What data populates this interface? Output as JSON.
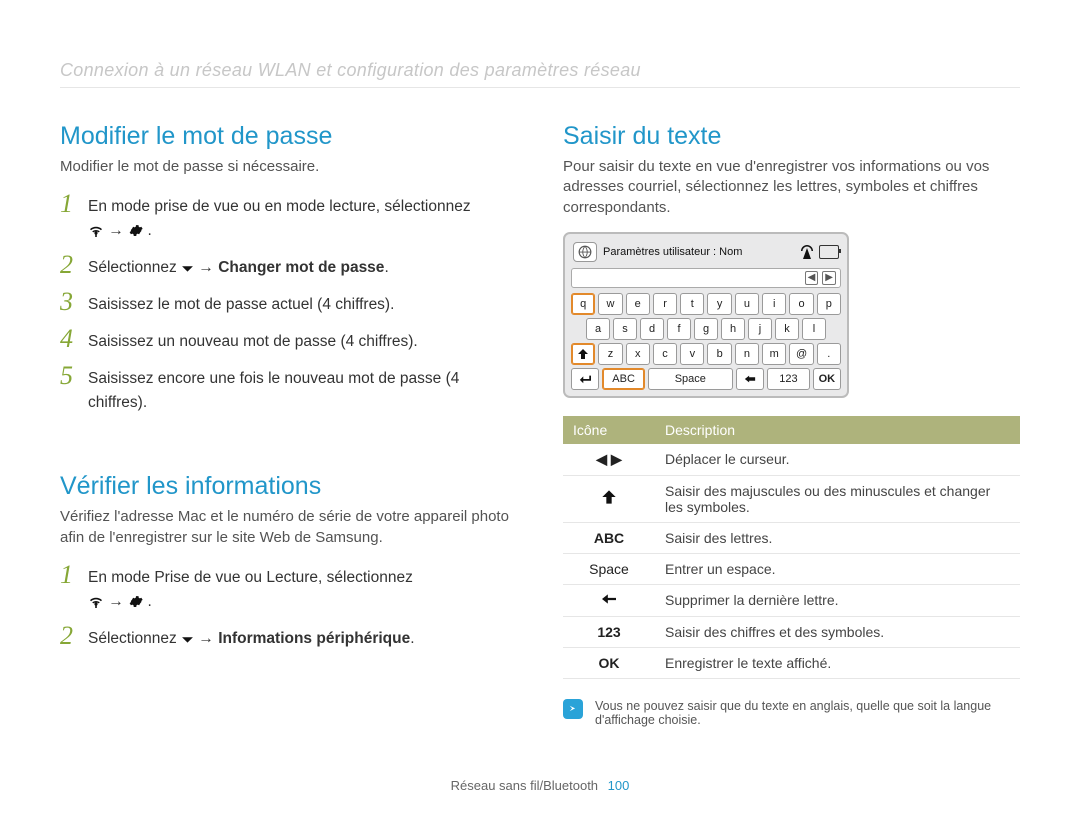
{
  "breadcrumb": "Connexion à un réseau WLAN et configuration des paramètres réseau",
  "arrow": "→",
  "left": {
    "password": {
      "title": "Modifier le mot de passe",
      "lead": "Modifier le mot de passe si nécessaire.",
      "steps": [
        "En mode prise de vue ou en mode lecture, sélectionnez",
        {
          "pre": "Sélectionnez ",
          "bold": "Changer mot de passe",
          "post": "."
        },
        "Saisissez le mot de passe actuel (4 chiffres).",
        "Saisissez un nouveau mot de passe (4 chiffres).",
        "Saisissez encore une fois le nouveau mot de passe (4 chiffres)."
      ]
    },
    "verify": {
      "title": "Vérifier les informations",
      "lead": "Vérifiez l'adresse Mac et le numéro de série de votre appareil photo afin de l'enregistrer sur le site Web de Samsung.",
      "steps": [
        "En mode Prise de vue ou Lecture, sélectionnez",
        {
          "pre": "Sélectionnez ",
          "bold": "Informations périphérique",
          "post": "."
        }
      ]
    }
  },
  "right": {
    "enter": {
      "title": "Saisir du texte",
      "lead": "Pour saisir du texte en vue d'enregistrer vos informations ou vos adresses courriel, sélectionnez les lettres, symboles et chiffres correspondants."
    },
    "keyboard": {
      "top_label": "Paramètres utilisateur : Nom",
      "cursor_left": "◀",
      "cursor_right": "▶",
      "rows": [
        [
          "q",
          "w",
          "e",
          "r",
          "t",
          "y",
          "u",
          "i",
          "o",
          "p"
        ],
        [
          "a",
          "s",
          "d",
          "f",
          "g",
          "h",
          "j",
          "k",
          "l"
        ],
        [
          "z",
          "x",
          "c",
          "v",
          "b",
          "n",
          "m",
          "@",
          "."
        ]
      ],
      "bottom": {
        "abc": "ABC",
        "space": "Space",
        "num": "123",
        "ok": "OK"
      }
    },
    "table": {
      "h1": "Icône",
      "h2": "Description",
      "rows": [
        {
          "icon": "◀  ▶",
          "desc": "Déplacer le curseur."
        },
        {
          "icon": "shift",
          "desc": "Saisir des majuscules ou des minuscules et changer les symboles."
        },
        {
          "icon": "ABC",
          "desc": "Saisir des lettres."
        },
        {
          "icon": "Space",
          "desc": "Entrer un espace."
        },
        {
          "icon": "bksp",
          "desc": "Supprimer la dernière lettre."
        },
        {
          "icon": "123",
          "desc": "Saisir des chiffres et des symboles."
        },
        {
          "icon": "OK",
          "desc": "Enregistrer le texte affiché."
        }
      ]
    },
    "note": "Vous ne pouvez saisir que du texte en anglais, quelle que soit la langue d'affichage choisie."
  },
  "footer": {
    "section": "Réseau sans fil/Bluetooth",
    "page": "100"
  }
}
